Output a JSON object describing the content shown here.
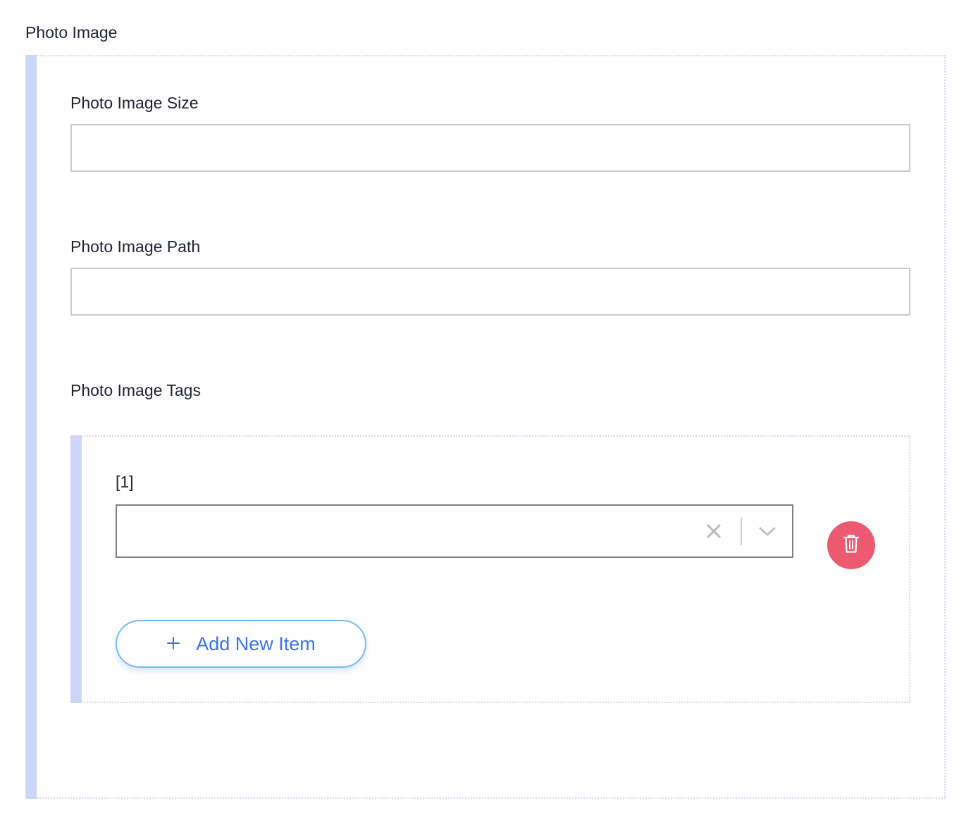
{
  "section": {
    "title": "Photo Image"
  },
  "fields": {
    "size": {
      "label": "Photo Image Size",
      "value": ""
    },
    "path": {
      "label": "Photo Image Path",
      "value": ""
    },
    "tags": {
      "label": "Photo Image Tags"
    }
  },
  "tags_list": {
    "items": [
      {
        "index_label": "[1]",
        "selected_value": ""
      }
    ],
    "add_button_label": "Add New Item",
    "add_button_icon": "plus-icon",
    "delete_icon": "trash-icon",
    "clear_icon": "close-icon",
    "dropdown_icon": "chevron-down-icon"
  },
  "colors": {
    "accent_bar": "#cdd5fb",
    "delete_button": "#ec5a72",
    "add_button_text": "#3a72ee",
    "add_button_border": "#73bdf2"
  }
}
